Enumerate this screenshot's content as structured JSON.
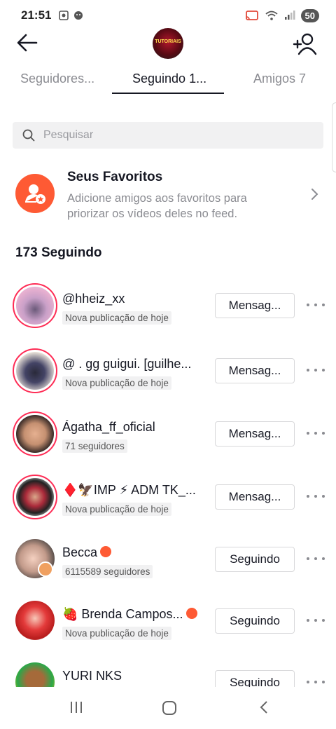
{
  "status": {
    "time": "21:51",
    "battery": "50"
  },
  "header": {
    "profile_badge": "TUTORIAIS"
  },
  "tabs": [
    {
      "label": "Seguidores..."
    },
    {
      "label": "Seguindo 1..."
    },
    {
      "label": "Amigos 7"
    }
  ],
  "search": {
    "placeholder": "Pesquisar"
  },
  "favorites": {
    "title": "Seus Favoritos",
    "description": "Adicione amigos aos favoritos para priorizar os vídeos deles no feed."
  },
  "following_count": "173 Seguindo",
  "accounts": [
    {
      "name": "@hheiz_xx",
      "sub": "Nova publicação de hoje",
      "button": "Mensag..."
    },
    {
      "name": "@ . gg guigui. [guilhe...",
      "sub": "Nova publicação de hoje",
      "button": "Mensag..."
    },
    {
      "name": "Ágatha_ff_oficial",
      "sub": "71 seguidores",
      "button": "Mensag..."
    },
    {
      "name": "♦️🦅IMP ⚡ ADM TK_...",
      "sub": "Nova publicação de hoje",
      "button": "Mensag..."
    },
    {
      "name": "Becca",
      "sub": "6115589 seguidores",
      "button": "Seguindo"
    },
    {
      "name": "🍓 Brenda Campos...",
      "sub": "Nova publicação de hoje",
      "button": "Seguindo"
    },
    {
      "name": "YURI NKS",
      "sub": "",
      "button": "Seguindo"
    }
  ]
}
